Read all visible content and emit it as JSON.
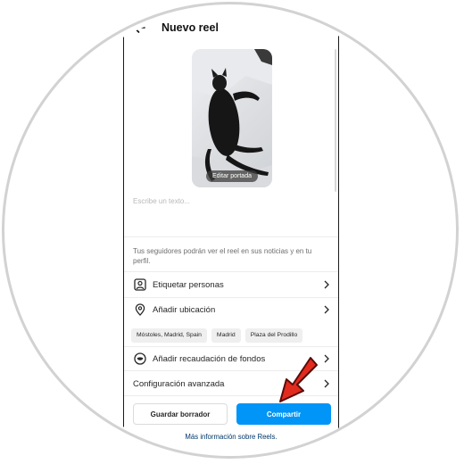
{
  "header": {
    "title": "Nuevo reel"
  },
  "cover": {
    "edit_label": "Editar portada"
  },
  "caption": {
    "placeholder": "Escribe un texto..."
  },
  "notice": {
    "text": "Tus seguidores podrán ver el reel en sus noticias y en tu perfil."
  },
  "options": {
    "tag_people": "Etiquetar personas",
    "add_location": "Añadir ubicación",
    "add_fundraiser": "Añadir recaudación de fondos",
    "advanced_settings": "Configuración avanzada"
  },
  "location_chips": [
    "Móstoles, Madrid, Spain",
    "Madrid",
    "Plaza del Prodillo"
  ],
  "actions": {
    "save_draft": "Guardar borrador",
    "share": "Compartir"
  },
  "footer": {
    "more_info": "Más información sobre Reels."
  },
  "colors": {
    "primary": "#0095f6",
    "link": "#00376b",
    "arrow": "#e02b1e"
  },
  "icons": [
    "back-arrow-icon",
    "tag-person-icon",
    "location-pin-icon",
    "fundraiser-icon",
    "chevron-right-icon"
  ]
}
